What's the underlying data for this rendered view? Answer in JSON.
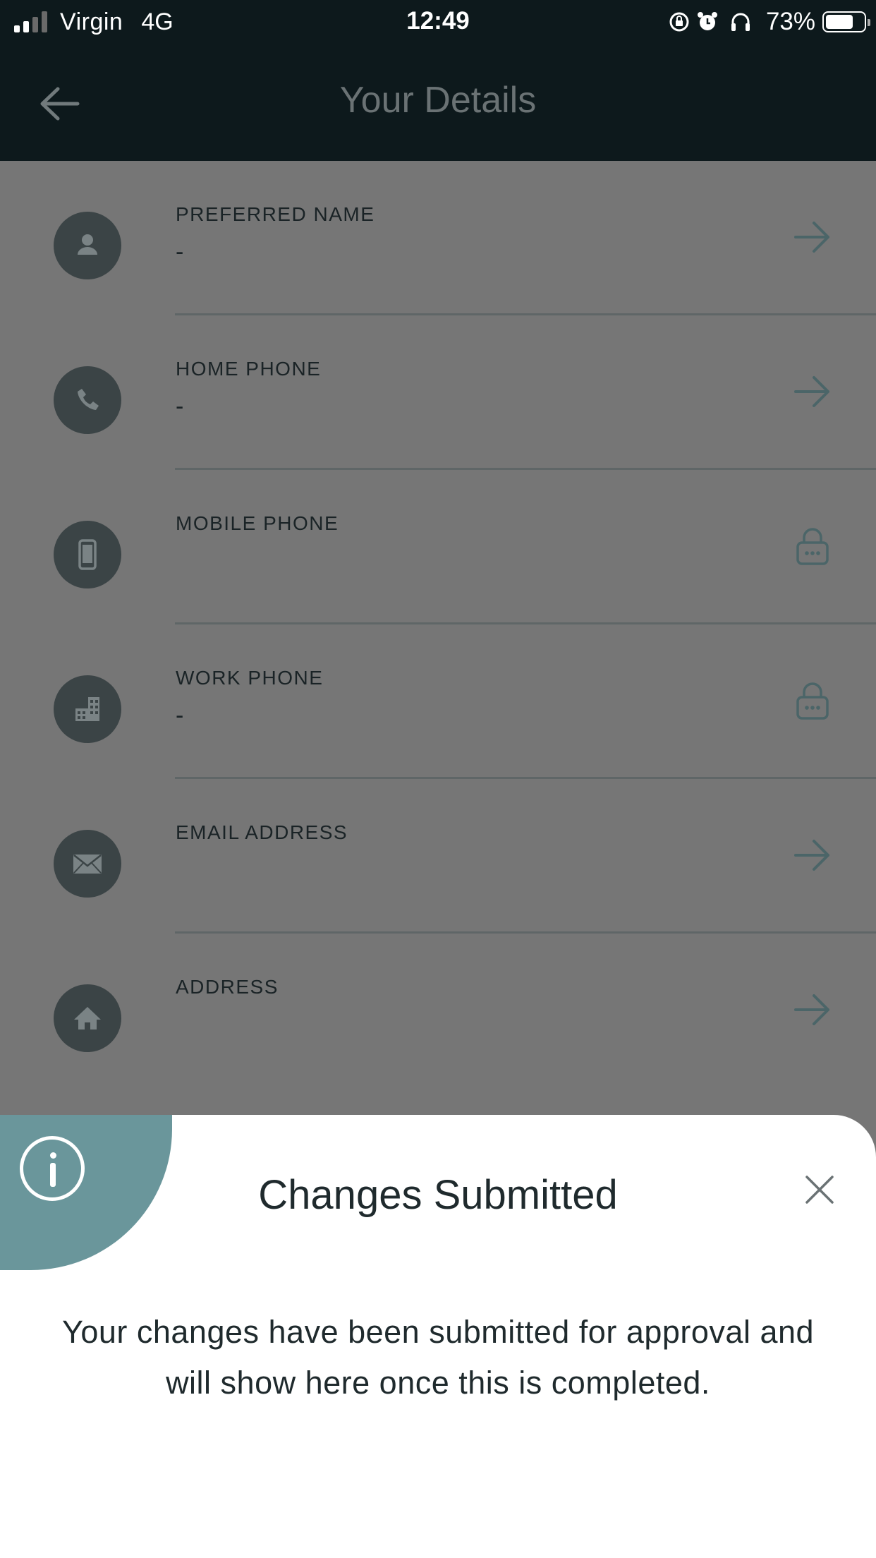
{
  "status_bar": {
    "carrier": "Virgin",
    "network": "4G",
    "time": "12:49",
    "battery_percent": "73%",
    "battery_level": 0.73,
    "signal_bars_active": 2,
    "signal_bars_total": 4
  },
  "nav": {
    "title": "Your Details"
  },
  "details": [
    {
      "label": "PREFERRED NAME",
      "value": "-",
      "icon": "person-icon",
      "action": "arrow"
    },
    {
      "label": "HOME PHONE",
      "value": "-",
      "icon": "phone-icon",
      "action": "arrow"
    },
    {
      "label": "MOBILE PHONE",
      "value": "",
      "icon": "mobile-icon",
      "action": "lock"
    },
    {
      "label": "WORK PHONE",
      "value": "-",
      "icon": "building-icon",
      "action": "lock"
    },
    {
      "label": "EMAIL ADDRESS",
      "value": "",
      "icon": "mail-icon",
      "action": "arrow"
    },
    {
      "label": "ADDRESS",
      "value": "",
      "icon": "home-icon",
      "action": "arrow"
    }
  ],
  "sheet": {
    "title": "Changes Submitted",
    "message": "Your changes have been submitted for approval and will show here once this is completed."
  },
  "colors": {
    "header_bg": "#0d191c",
    "overlay_bg": "#767676",
    "accent_teal": "#6a969b",
    "icon_circle": "#3b4446",
    "action_icon": "#4b6568"
  }
}
